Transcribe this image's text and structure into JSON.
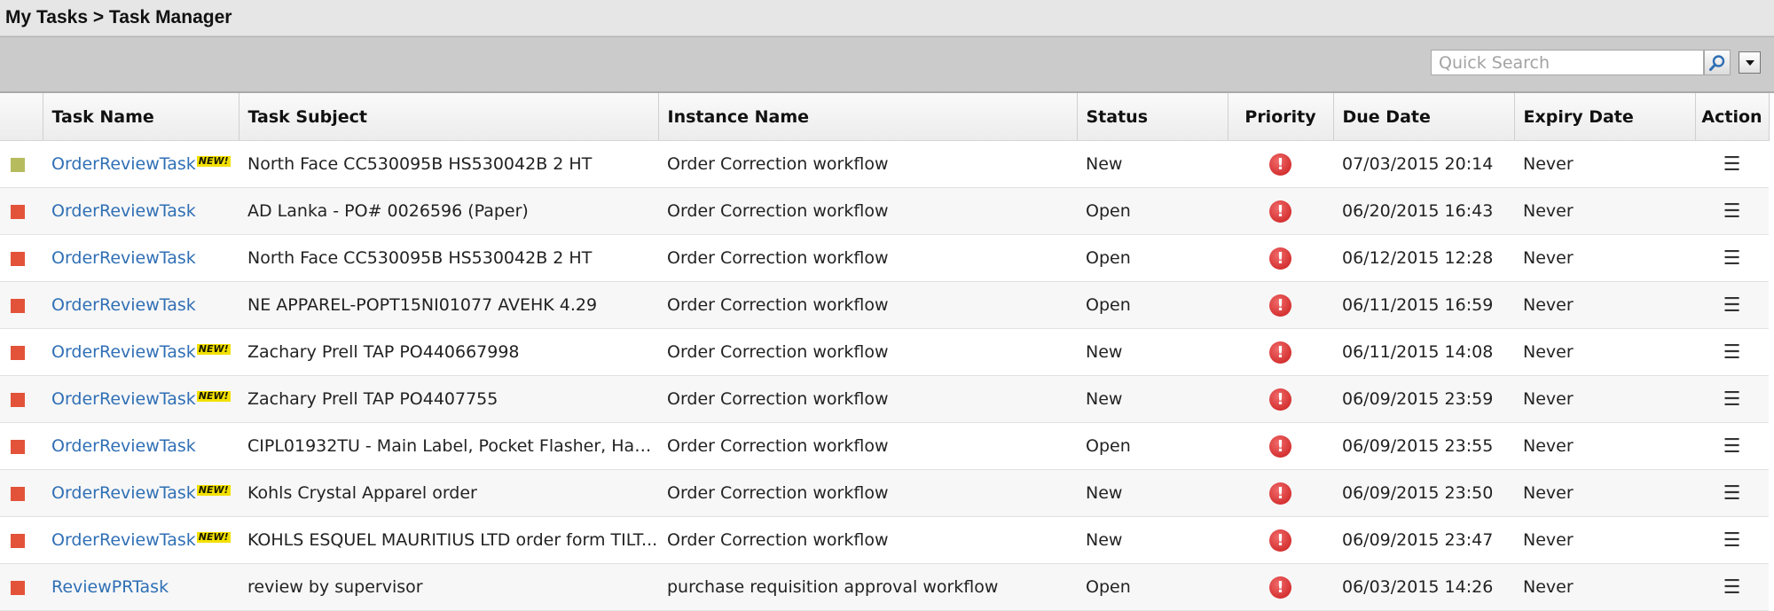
{
  "breadcrumb": "My Tasks > Task Manager",
  "search": {
    "placeholder": "Quick Search"
  },
  "columns": {
    "task_name": "Task Name",
    "task_subject": "Task Subject",
    "instance_name": "Instance Name",
    "status": "Status",
    "priority": "Priority",
    "due_date": "Due Date",
    "expiry_date": "Expiry Date",
    "action": "Action"
  },
  "colors": {
    "flag_green": "#b6bb5e",
    "flag_red": "#e2533a",
    "link": "#2f6fb5",
    "new_badge": "#f2e000",
    "priority_high": "#d32a2a"
  },
  "icons": {
    "priority": "!",
    "action": "☰"
  },
  "new_badge": "NEW!",
  "rows": [
    {
      "flag": "green",
      "task_name": "OrderReviewTask",
      "is_new": true,
      "subject": "North Face CC530095B HS530042B 2 HT",
      "instance": "Order Correction workflow",
      "status": "New",
      "due": "07/03/2015 20:14",
      "expiry": "Never"
    },
    {
      "flag": "red",
      "task_name": "OrderReviewTask",
      "is_new": false,
      "subject": "AD Lanka - PO# 0026596 (Paper)",
      "instance": "Order Correction workflow",
      "status": "Open",
      "due": "06/20/2015 16:43",
      "expiry": "Never"
    },
    {
      "flag": "red",
      "task_name": "OrderReviewTask",
      "is_new": false,
      "subject": "North Face CC530095B HS530042B 2 HT",
      "instance": "Order Correction workflow",
      "status": "Open",
      "due": "06/12/2015 12:28",
      "expiry": "Never"
    },
    {
      "flag": "red",
      "task_name": "OrderReviewTask",
      "is_new": false,
      "subject": "NE APPAREL-POPT15NI01077 AVEHK 4.29",
      "instance": "Order Correction workflow",
      "status": "Open",
      "due": "06/11/2015 16:59",
      "expiry": "Never"
    },
    {
      "flag": "red",
      "task_name": "OrderReviewTask",
      "is_new": true,
      "subject": "Zachary Prell TAP PO440667998",
      "instance": "Order Correction workflow",
      "status": "New",
      "due": "06/11/2015 14:08",
      "expiry": "Never"
    },
    {
      "flag": "red",
      "task_name": "OrderReviewTask",
      "is_new": true,
      "subject": "Zachary Prell TAP PO4407755",
      "instance": "Order Correction workflow",
      "status": "New",
      "due": "06/09/2015 23:59",
      "expiry": "Never"
    },
    {
      "flag": "red",
      "task_name": "OrderReviewTask",
      "is_new": false,
      "subject": "CIPL01932TU - Main Label, Pocket Flasher, Han...",
      "instance": "Order Correction workflow",
      "status": "Open",
      "due": "06/09/2015 23:55",
      "expiry": "Never"
    },
    {
      "flag": "red",
      "task_name": "OrderReviewTask",
      "is_new": true,
      "subject": "Kohls Crystal Apparel order",
      "instance": "Order Correction workflow",
      "status": "New",
      "due": "06/09/2015 23:50",
      "expiry": "Never"
    },
    {
      "flag": "red",
      "task_name": "OrderReviewTask",
      "is_new": true,
      "subject": "KOHLS ESQUEL MAURITIUS LTD order form TILT...",
      "instance": "Order Correction workflow",
      "status": "New",
      "due": "06/09/2015 23:47",
      "expiry": "Never"
    },
    {
      "flag": "red",
      "task_name": "ReviewPRTask",
      "is_new": false,
      "subject": "review by supervisor",
      "instance": "purchase requisition approval workflow",
      "status": "Open",
      "due": "06/03/2015 14:26",
      "expiry": "Never"
    }
  ]
}
